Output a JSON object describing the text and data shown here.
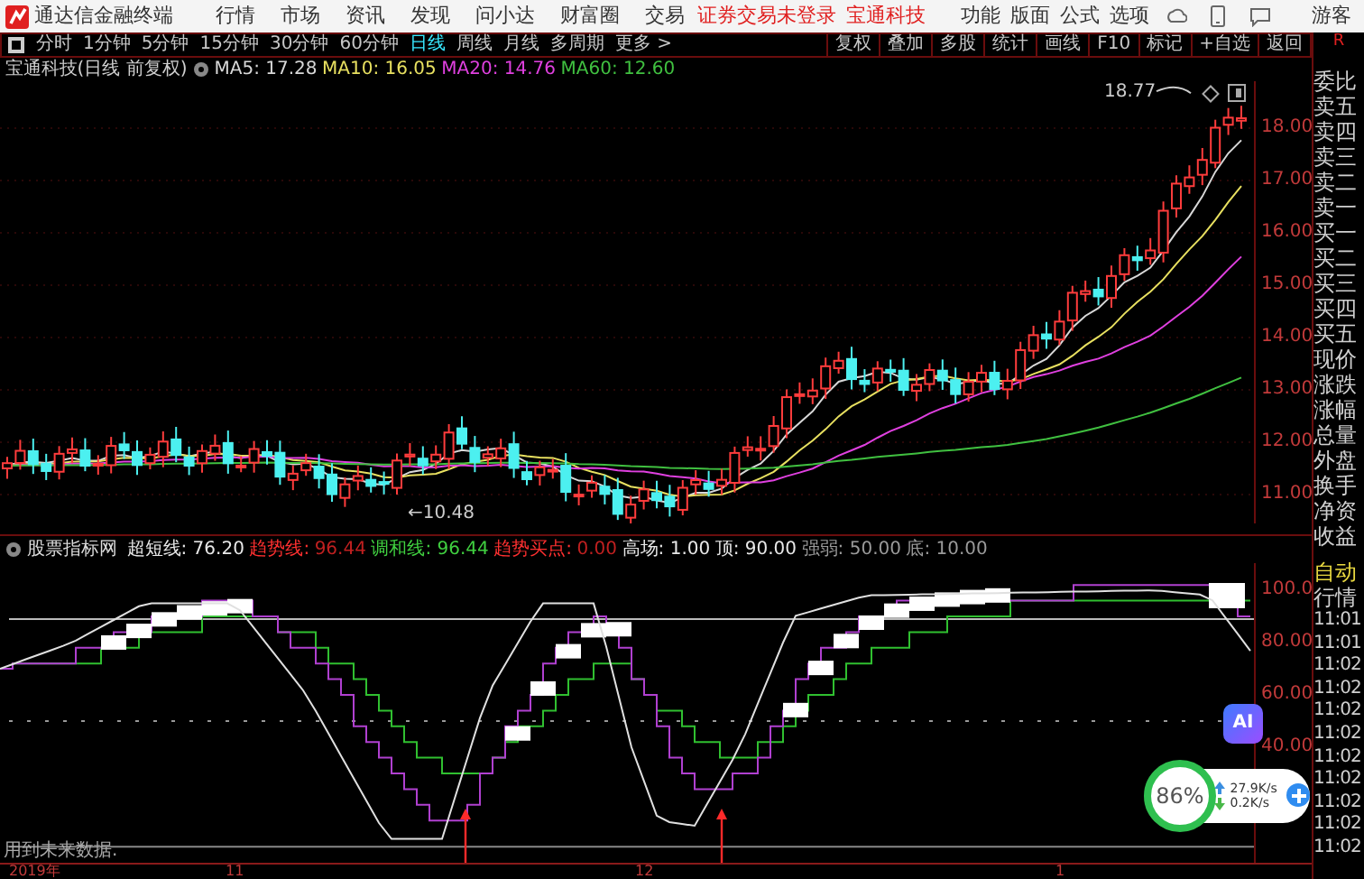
{
  "app_bar": {
    "title": "通达信金融终端",
    "menus": [
      "行情",
      "市场",
      "资讯",
      "发现",
      "问小达",
      "财富圈",
      "交易"
    ],
    "login_status": "证券交易未登录",
    "stock_name": "宝通科技",
    "tools": [
      "功能",
      "版面",
      "公式",
      "选项"
    ],
    "user": "游客"
  },
  "period_bar": {
    "periods": [
      {
        "label": "分时",
        "selected": false
      },
      {
        "label": "1分钟",
        "selected": false
      },
      {
        "label": "5分钟",
        "selected": false
      },
      {
        "label": "15分钟",
        "selected": false
      },
      {
        "label": "30分钟",
        "selected": false
      },
      {
        "label": "60分钟",
        "selected": false
      },
      {
        "label": "日线",
        "selected": true
      },
      {
        "label": "周线",
        "selected": false
      },
      {
        "label": "月线",
        "selected": false
      },
      {
        "label": "多周期",
        "selected": false
      },
      {
        "label": "更多 >",
        "selected": false
      }
    ],
    "buttons": [
      "复权",
      "叠加",
      "多股",
      "统计",
      "画线",
      "F10",
      "标记",
      "+自选",
      "返回"
    ]
  },
  "corner_mark": "R",
  "main_chart": {
    "title": "宝通科技(日线 前复权)",
    "ma": [
      {
        "label": "MA5: 17.28",
        "color": "#d8d8d8"
      },
      {
        "label": "MA10: 16.05",
        "color": "#e8e060"
      },
      {
        "label": "MA20: 14.76",
        "color": "#e040e0"
      },
      {
        "label": "MA60: 12.60",
        "color": "#40c040"
      }
    ],
    "price_ticks": [
      "18.00",
      "17.00",
      "16.00",
      "15.00",
      "14.00",
      "13.00",
      "12.00",
      "11.00"
    ],
    "high_label": "18.77",
    "low_label": "←10.48"
  },
  "quote_panel": {
    "labels": [
      "委比",
      "卖五",
      "卖四",
      "卖三",
      "卖二",
      "卖一",
      "买一",
      "买二",
      "买三",
      "买四",
      "买五",
      "现价",
      "涨跌",
      "涨幅",
      "总量",
      "外盘",
      "换手",
      "净资",
      "收益"
    ]
  },
  "indicator": {
    "name": "股票指标网",
    "values": [
      {
        "label": "超短线: 76.20",
        "color": "#e8e8e8"
      },
      {
        "label": "趋势线:",
        "color": "#ff3030"
      },
      {
        "label": "96.44",
        "color": "#c02020"
      },
      {
        "label": "调和线: 96.44",
        "color": "#40d040"
      },
      {
        "label": "趋势买点:",
        "color": "#ff3030"
      },
      {
        "label": "0.00",
        "color": "#c02020"
      },
      {
        "label": "高场: 1.00",
        "color": "#e8e8e8"
      },
      {
        "label": "顶: 90.00",
        "color": "#e8e8e8"
      },
      {
        "label": "强弱: 50.00",
        "color": "#9a9a9a"
      },
      {
        "label": "底: 10.00",
        "color": "#9a9a9a"
      }
    ],
    "ticks": [
      "100.0",
      "80.00",
      "60.00",
      "40.00"
    ],
    "note": "用到未来数据."
  },
  "side_panel": {
    "mode": "自动",
    "title": "行情",
    "times": [
      "11:01",
      "11:01",
      "11:02",
      "11:02",
      "11:02",
      "11:02",
      "11:02",
      "11:02",
      "11:02",
      "11:02",
      "11:02"
    ]
  },
  "date_axis": [
    "2019年",
    "11",
    "12",
    "1"
  ],
  "ai_button": "AI",
  "speed_widget": {
    "percent": "86%",
    "upload": "27.9K/s",
    "download": "0.2K/s"
  }
}
